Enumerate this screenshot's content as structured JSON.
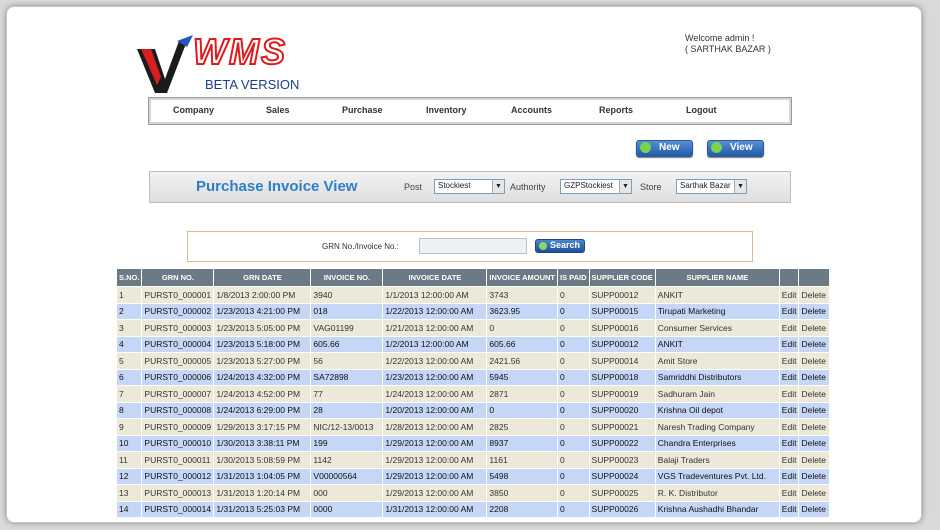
{
  "logo": {
    "wms": "WMS",
    "beta": "BETA VERSION"
  },
  "welcome": {
    "line1": "Welcome admin !",
    "line2": "( SARTHAK BAZAR )"
  },
  "nav": [
    "Company",
    "Sales",
    "Purchase",
    "Inventory",
    "Accounts",
    "Reports",
    "Logout"
  ],
  "buttons": {
    "new": "New",
    "view": "View",
    "search": "Search"
  },
  "filter": {
    "title": "Purchase Invoice View",
    "post_label": "Post",
    "post_value": "Stockiest",
    "authority_label": "Authority",
    "authority_value": "GZPStockiest",
    "store_label": "Store",
    "store_value": "Sarthak Bazar"
  },
  "search": {
    "label": "GRN No./Invoice No.:",
    "value": ""
  },
  "table": {
    "headers": [
      "S.NO.",
      "GRN NO.",
      "GRN DATE",
      "INVOICE NO.",
      "INVOICE DATE",
      "INVOICE AMOUNT",
      "IS PAID",
      "SUPPLIER CODE",
      "SUPPLIER NAME",
      "",
      ""
    ],
    "edit_label": "Edit",
    "delete_label": "Delete",
    "rows": [
      [
        "1",
        "PURST0_000001",
        "1/8/2013 2:00:00 PM",
        "3940",
        "1/1/2013 12:00:00 AM",
        "3743",
        "0",
        "SUPP00012",
        "ANKIT"
      ],
      [
        "2",
        "PURST0_000002",
        "1/23/2013 4:21:00 PM",
        "018",
        "1/22/2013 12:00:00 AM",
        "3623.95",
        "0",
        "SUPP00015",
        "Tirupati Marketing"
      ],
      [
        "3",
        "PURST0_000003",
        "1/23/2013 5:05:00 PM",
        "VAG01199",
        "1/21/2013 12:00:00 AM",
        "0",
        "0",
        "SUPP00016",
        "Consumer Services"
      ],
      [
        "4",
        "PURST0_000004",
        "1/23/2013 5:18:00 PM",
        "605.66",
        "1/2/2013 12:00:00 AM",
        "605.66",
        "0",
        "SUPP00012",
        "ANKIT"
      ],
      [
        "5",
        "PURST0_000005",
        "1/23/2013 5:27:00 PM",
        "56",
        "1/22/2013 12:00:00 AM",
        "2421.56",
        "0",
        "SUPP00014",
        "Amit Store"
      ],
      [
        "6",
        "PURST0_000006",
        "1/24/2013 4:32:00 PM",
        "SA72898",
        "1/23/2013 12:00:00 AM",
        "5945",
        "0",
        "SUPP00018",
        "Samriddhi Distributors"
      ],
      [
        "7",
        "PURST0_000007",
        "1/24/2013 4:52:00 PM",
        "77",
        "1/24/2013 12:00:00 AM",
        "2871",
        "0",
        "SUPP00019",
        "Sadhuram Jain"
      ],
      [
        "8",
        "PURST0_000008",
        "1/24/2013 6:29:00 PM",
        "28",
        "1/20/2013 12:00:00 AM",
        "0",
        "0",
        "SUPP00020",
        "Krishna Oil depot"
      ],
      [
        "9",
        "PURST0_000009",
        "1/29/2013 3:17:15 PM",
        "NIC/12-13/0013",
        "1/28/2013 12:00:00 AM",
        "2825",
        "0",
        "SUPP00021",
        "Naresh Trading Company"
      ],
      [
        "10",
        "PURST0_000010",
        "1/30/2013 3:38:11 PM",
        "199",
        "1/29/2013 12:00:00 AM",
        "8937",
        "0",
        "SUPP00022",
        "Chandra Enterprises"
      ],
      [
        "11",
        "PURST0_000011",
        "1/30/2013 5:08:59 PM",
        "1142",
        "1/29/2013 12:00:00 AM",
        "1161",
        "0",
        "SUPP00023",
        "Balaji Traders"
      ],
      [
        "12",
        "PURST0_000012",
        "1/31/2013 1:04:05 PM",
        "V00000564",
        "1/29/2013 12:00:00 AM",
        "5498",
        "0",
        "SUPP00024",
        "VGS Tradeventures Pvt. Ltd."
      ],
      [
        "13",
        "PURST0_000013",
        "1/31/2013 1:20:14 PM",
        "000",
        "1/29/2013 12:00:00 AM",
        "3850",
        "0",
        "SUPP00025",
        "R. K. Distributor"
      ],
      [
        "14",
        "PURST0_000014",
        "1/31/2013 5:25:03 PM",
        "0000",
        "1/31/2013 12:00:00 AM",
        "2208",
        "0",
        "SUPP00026",
        "Krishna Aushadhi Bhandar"
      ]
    ]
  }
}
